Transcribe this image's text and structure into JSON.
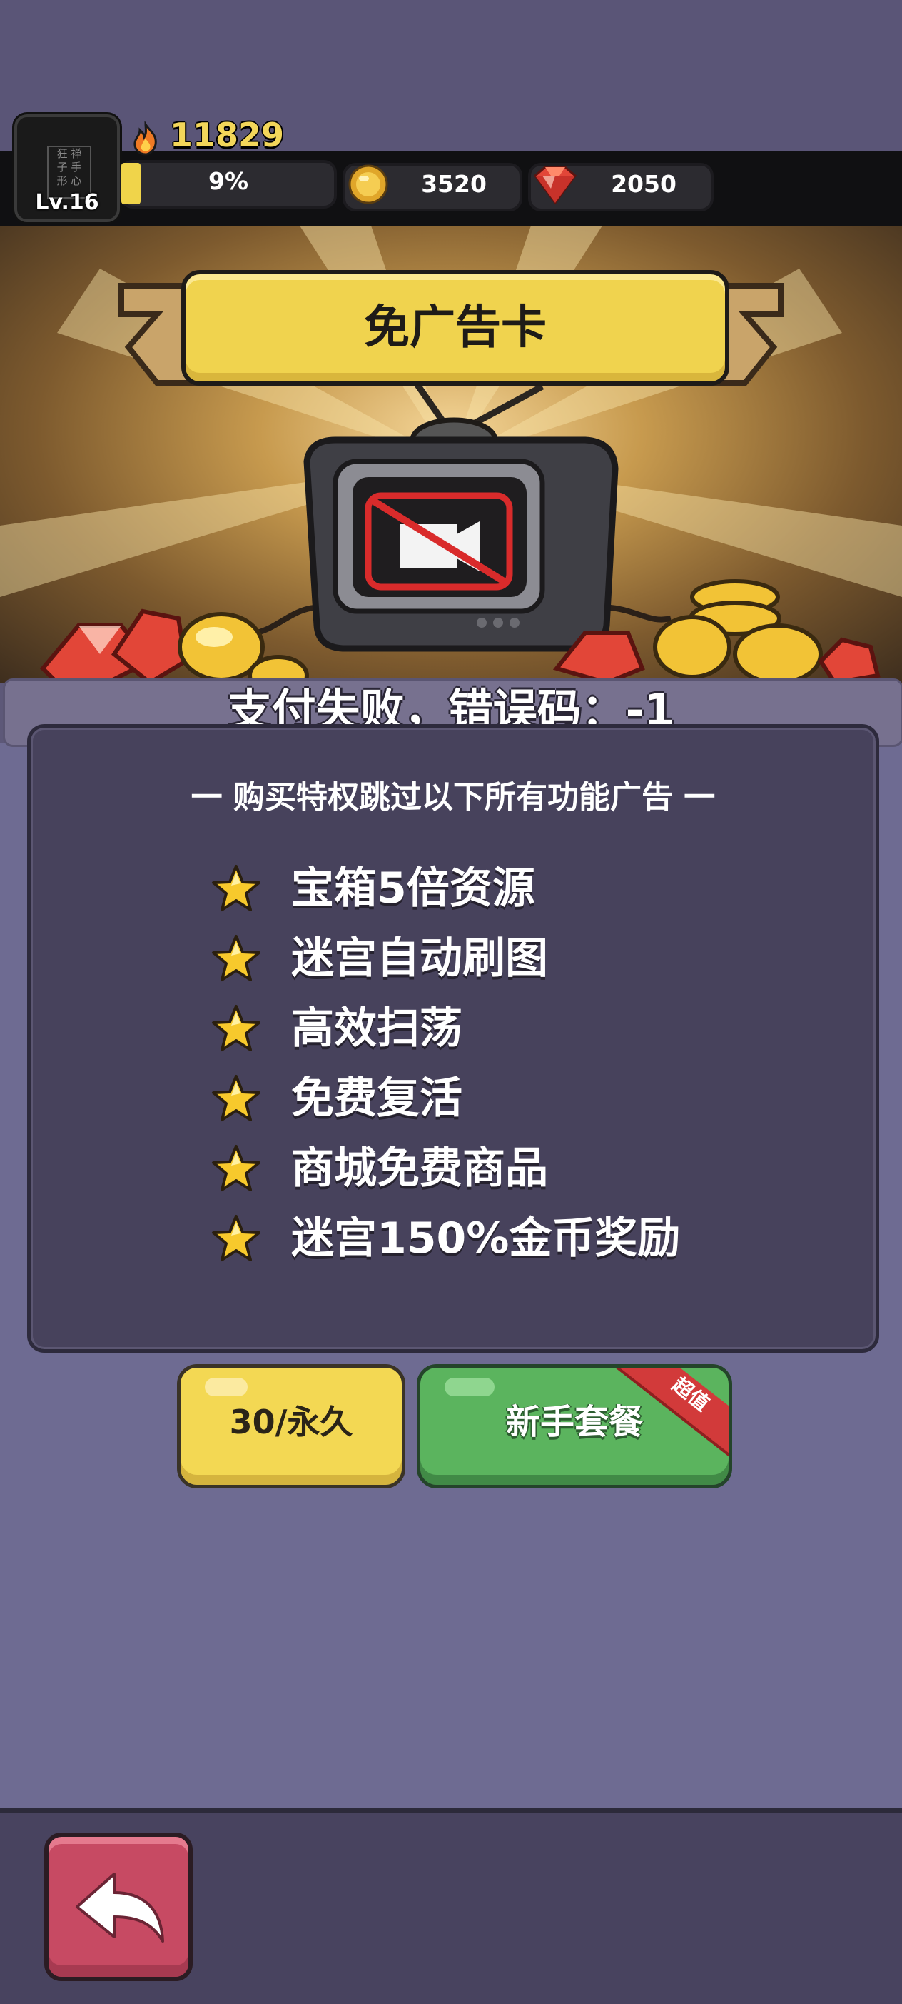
{
  "header": {
    "level": "Lv.16",
    "avatar_text": "狂 禅\n子 手\n形 心",
    "score": "11829",
    "progress_label": "9%",
    "progress_value": 0.09,
    "coins": "3520",
    "gems": "2050"
  },
  "banner": {
    "title": "免广告卡"
  },
  "status": {
    "message": "支付失败，错误码：-1"
  },
  "card": {
    "subtitle": "一 购买特权跳过以下所有功能广告 一",
    "features": [
      "宝箱5倍资源",
      "迷宫自动刷图",
      "高效扫荡",
      "免费复活",
      "商城免费商品",
      "迷宫150%金币奖励"
    ]
  },
  "buttons": {
    "buy_label": "30/永久",
    "pack_label": "新手套餐",
    "pack_ribbon": "超值"
  },
  "icons": {
    "fire": "fire-icon",
    "coin": "coin-icon",
    "gem": "gem-icon",
    "star": "star-icon",
    "back": "back-arrow-icon",
    "tv": "no-ad-tv-icon"
  },
  "colors": {
    "accent_yellow": "#f0d34e",
    "green_button": "#5bb45e",
    "red_back": "#c74a63",
    "panel": "#47425c"
  }
}
